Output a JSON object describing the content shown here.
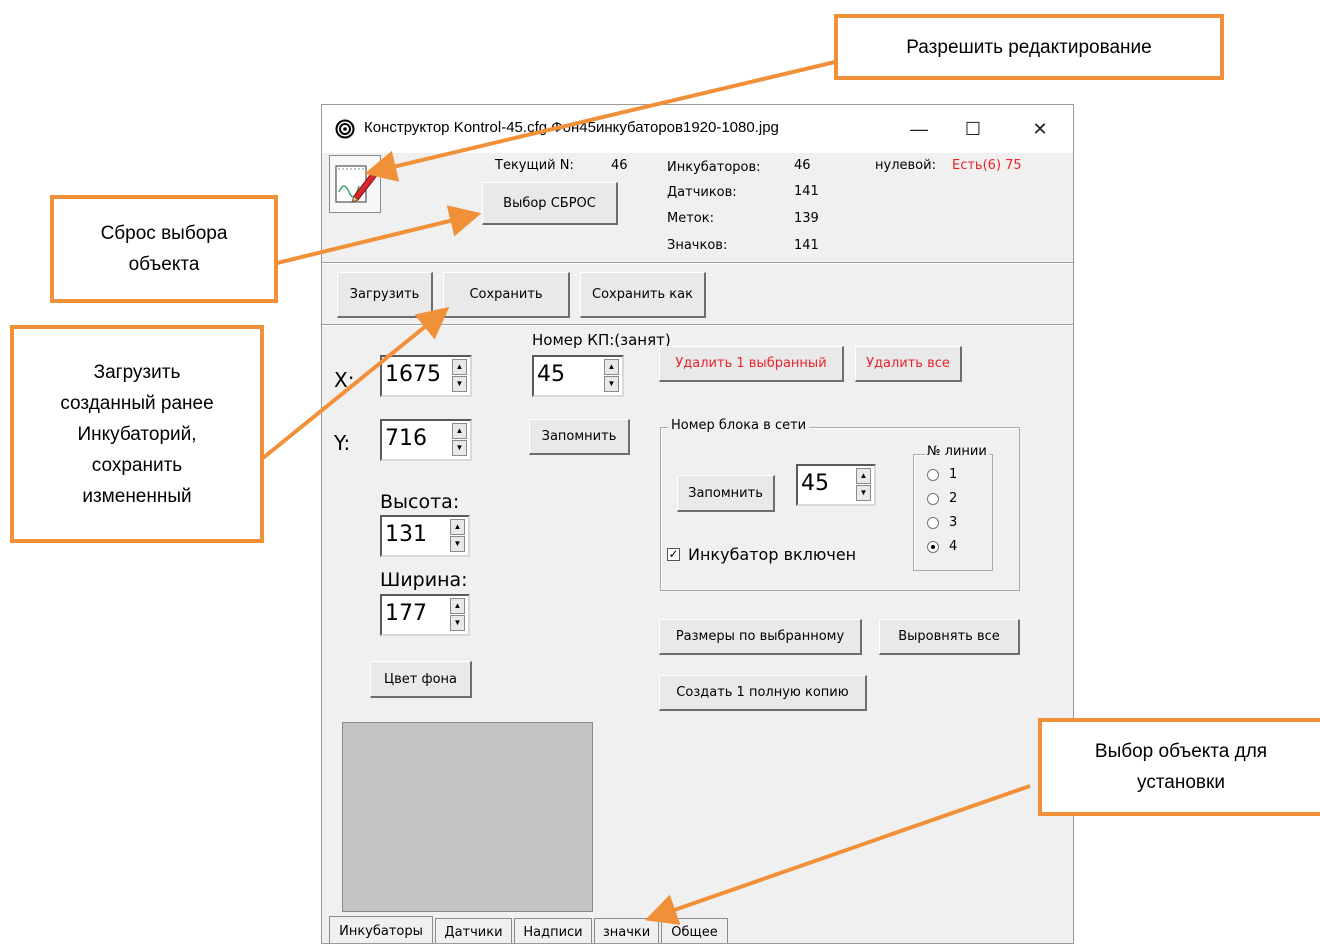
{
  "annotations": {
    "enable_editing": "Разрешить редактирование",
    "reset_selection": "Сброс выбора\nобъекта",
    "load_save": "Загрузить\nсозданный ранее\nИнкубаторий,\nсохранить\nизмененный",
    "choose_object": "Выбор объекта для\nустановки",
    "arrow_color": "#f0913a"
  },
  "window": {
    "title": "Конструктор  Kontrol-45.cfg   Фон45инкубаторов1920-1080.jpg",
    "minimize": "—",
    "maximize": "☐",
    "close": "✕"
  },
  "header": {
    "current_n_label": "Текущий N:",
    "current_n_value": "46",
    "reset_button": "Выбор СБРОС",
    "stats": [
      {
        "label": "Инкубаторов:",
        "value": "46"
      },
      {
        "label": "Датчиков:",
        "value": "141"
      },
      {
        "label": "Меток:",
        "value": "139"
      },
      {
        "label": "Значков:",
        "value": "141"
      }
    ],
    "zero_label": "нулевой:",
    "zero_value": "Есть(6) 75",
    "zero_value_color": "#e8242a"
  },
  "toolbar": {
    "load": "Загрузить",
    "save": "Сохранить",
    "save_as": "Сохранить как"
  },
  "main": {
    "x_label": "X:",
    "x_value": "1675",
    "y_label": "Y:",
    "y_value": "716",
    "kp_label": "Номер КП:(занят)",
    "kp_value": "45",
    "remember_button": "Запомнить",
    "delete_one_button": "Удалить 1 выбранный",
    "delete_all_button": "Удалить все",
    "height_label": "Высота:",
    "height_value": "131",
    "width_label": "Ширина:",
    "width_value": "177",
    "bg_color_button": "Цвет фона",
    "preview_color": "#c3c3c3",
    "network_group": {
      "title": "Номер блока в сети",
      "remember_button": "Запомнить",
      "block_value": "45",
      "enabled_label": "Инкубатор включен",
      "enabled_checked": true,
      "line_group_title": "№ линии",
      "lines": [
        "1",
        "2",
        "3",
        "4"
      ],
      "selected_line": "4"
    },
    "size_by_selected_button": "Размеры по выбранному",
    "align_all_button": "Выровнять все",
    "create_copy_button": "Создать 1 полную копию"
  },
  "tabs": [
    "Инкубаторы",
    "Датчики",
    "Надписи",
    "значки",
    "Общее"
  ],
  "active_tab": "Инкубаторы"
}
